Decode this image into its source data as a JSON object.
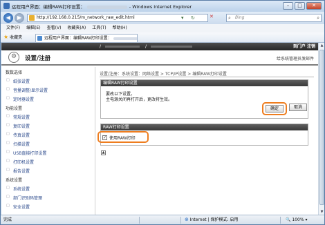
{
  "window": {
    "title": "远程用户界面：编辑RAW打印设置：",
    "title_suffix": "- Windows Internet Explorer",
    "buttons": {
      "minimize": "–",
      "maximize": "□",
      "close": "✕"
    }
  },
  "address": {
    "url": "http://192.168.0.215/m_network_raw_edit.html",
    "search_placeholder": "Bing",
    "back": "◀",
    "forward": "▶",
    "dropdown": "▾",
    "refresh": "↻",
    "stop": "✕"
  },
  "menu": [
    "文件(F)",
    "编辑(E)",
    "查看(V)",
    "收藏夹(A)",
    "工具(T)",
    "帮助(H)"
  ],
  "favorites": {
    "label": "收藏夹",
    "tab_title": "远程用户界面：编辑RAW打印设置："
  },
  "page_bar": {
    "sep1": "/",
    "sep2": "/",
    "links": "到门户  注销"
  },
  "app_header": {
    "title": "设置/注册",
    "mail_link": "给系统管理员发邮件"
  },
  "sidebar": {
    "sections": [
      {
        "label": "数数选择",
        "items": [
          "纸张设置",
          "音量调整/显示设置",
          "定时器设置"
        ]
      },
      {
        "label": "功能设置",
        "items": [
          "常规设置",
          "复印设置",
          "传真设置",
          "扫描设置",
          "USB直接打印设置",
          "打印机设置",
          "报告设置"
        ]
      },
      {
        "label": "系统设置",
        "items": [
          "系统设置",
          "部门识别码管理",
          "安全设置"
        ]
      }
    ]
  },
  "breadcrumb": "设置/注册：系统设置：网络设置 > TCP/IP设置 > 编辑RAW打印设置",
  "dialog": {
    "header": "编辑RAW打印设置",
    "message1": "要改以下设置。",
    "message2": "主电源关闭再打开后，更改将生效。",
    "ok_label": "确定",
    "cancel_label": "取消"
  },
  "raw_settings": {
    "header": "RAW打印设置",
    "checkbox_label": "使用RAW打印",
    "checked": true,
    "check_mark": "✓"
  },
  "top_link_icon": "▲",
  "statusbar": {
    "left": "完成",
    "zone": "Internet | 保护模式: 启用",
    "zoom": "100%",
    "zoom_icon": "🔍"
  },
  "colors": {
    "highlight": "#ee7d1f",
    "header_dark": "#3a3a3a",
    "link": "#2c4a8c"
  }
}
